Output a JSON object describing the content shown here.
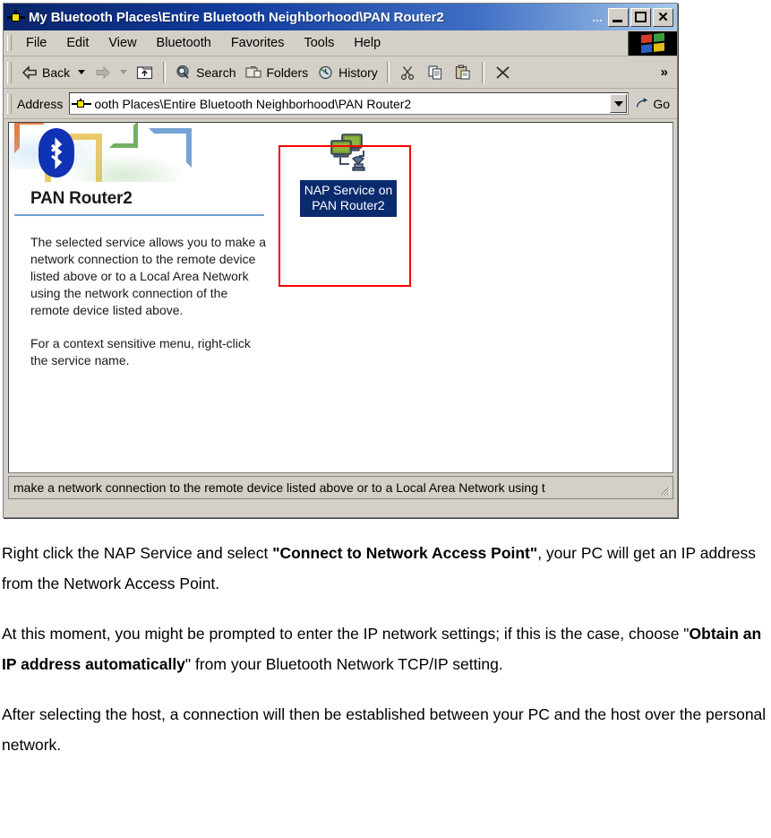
{
  "window": {
    "icon": "bluetooth-places-icon",
    "title": "My Bluetooth Places\\Entire Bluetooth Neighborhood\\PAN Router2",
    "title_ellipsis": "...",
    "buttons": {
      "minimize": "_",
      "maximize": "❐",
      "close": "×"
    }
  },
  "menubar": {
    "items": [
      {
        "label": "File"
      },
      {
        "label": "Edit"
      },
      {
        "label": "View"
      },
      {
        "label": "Bluetooth"
      },
      {
        "label": "Favorites"
      },
      {
        "label": "Tools"
      },
      {
        "label": "Help"
      }
    ],
    "brand_logo": "windows-flag-icon"
  },
  "toolbar": {
    "back_label": "Back",
    "forward_label": "",
    "up_label": "",
    "search_label": "Search",
    "folders_label": "Folders",
    "history_label": "History",
    "cut_label": "",
    "copy_label": "",
    "paste_label": "",
    "delete_label": "",
    "overflow_label": "»"
  },
  "addressbar": {
    "label": "Address",
    "value": "ooth Places\\Entire Bluetooth Neighborhood\\PAN Router2",
    "placeholder": "Address",
    "go_label": "Go"
  },
  "leftpane": {
    "heading": "PAN Router2",
    "paragraph1": "The selected service allows you to make a network connection to the remote device listed above or to a Local Area Network using the network connection of the remote device listed above.",
    "paragraph2": "For a context sensitive menu, right-click the service name."
  },
  "rightpane": {
    "item": {
      "icon": "nap-service-icon",
      "label": "NAP Service on PAN Router2",
      "selected": true,
      "selection_color": "#0a2a6e"
    },
    "annotation_color": "#ff0000"
  },
  "statusbar": {
    "text": "make a network connection to the remote device listed above or to a Local Area Network using t"
  },
  "document": {
    "p1_a": "Right click the NAP Service and select ",
    "p1_b": "\"Connect to Network Access Point\"",
    "p1_c": ", your PC will get an IP address from the Network Access Point.",
    "p2_a": "At this moment, you might be prompted to enter the IP network settings; if this is the case, choose \"",
    "p2_b": "Obtain an IP address automatically",
    "p2_c": "\" from your Bluetooth Network TCP/IP setting.",
    "p3": "After selecting the host, a connection will then be established between your PC and the host over the personal network."
  }
}
